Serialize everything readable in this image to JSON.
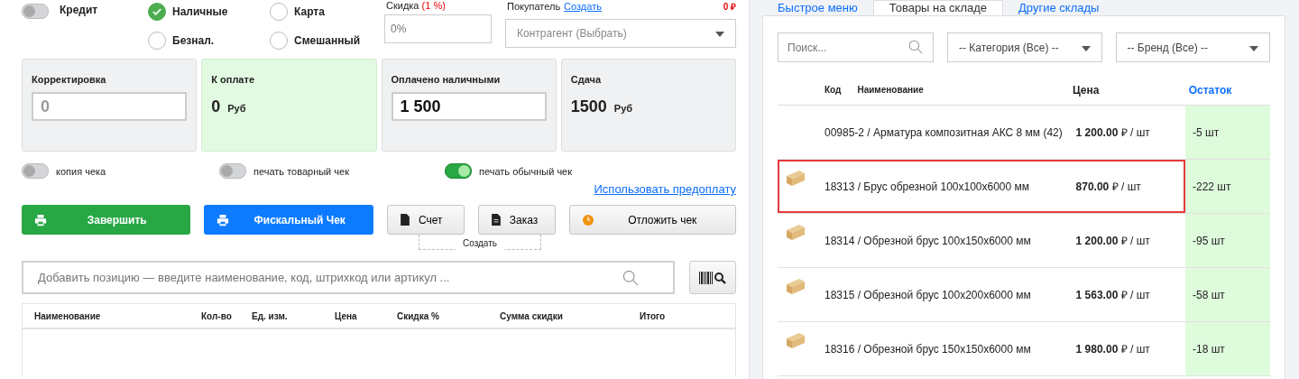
{
  "left": {
    "credit": {
      "label": "Кредит",
      "on": false
    },
    "payment_methods": [
      {
        "label": "Наличные",
        "selected": true
      },
      {
        "label": "Карта",
        "selected": false
      },
      {
        "label": "Безнал.",
        "selected": false
      },
      {
        "label": "Смешанный",
        "selected": false
      }
    ],
    "discount": {
      "label": "Скидка",
      "rate": "(1 %)",
      "placeholder": "0%"
    },
    "buyer": {
      "label": "Покупатель",
      "link": "Создать",
      "amount": "0 ₽",
      "placeholder": "Контрагент (Выбрать)"
    },
    "cards": [
      {
        "kind": "input",
        "title": "Корректировка",
        "placeholder": "0"
      },
      {
        "kind": "total",
        "title": "К оплате",
        "value": "0",
        "unit": "Руб"
      },
      {
        "kind": "input-strong",
        "title": "Оплачено наличными",
        "value": "1 500"
      },
      {
        "kind": "total-grey",
        "title": "Сдача",
        "value": "1500",
        "unit": "Руб"
      }
    ],
    "print_toggles": [
      {
        "label": "копия чека",
        "on": false
      },
      {
        "label": "печать товарный чек",
        "on": false
      },
      {
        "label": "печать обычный чек",
        "on": true
      }
    ],
    "prepay_link": "Использовать предоплату",
    "buttons": [
      {
        "kind": "green",
        "label": "Завершить"
      },
      {
        "kind": "blue",
        "label": "Фискальный Чек"
      },
      {
        "kind": "doc",
        "label": "Счет"
      },
      {
        "kind": "doc-lines",
        "label": "Заказ"
      },
      {
        "kind": "clock",
        "label": "Отложить чек"
      }
    ],
    "create_caption": "Создать",
    "search": {
      "placeholder": "Добавить позицию — введите наименование, код, штрихкод или артикул ..."
    },
    "table": {
      "columns": [
        "Наименование",
        "Кол-во",
        "Ед. изм.",
        "Цена",
        "Скидка %",
        "Сумма скидки",
        "Итого"
      ]
    }
  },
  "right": {
    "tabs": [
      {
        "label": "Быстрое меню",
        "selected": false
      },
      {
        "label": "Товары на складе",
        "selected": true
      },
      {
        "label": "Другие склады",
        "selected": false
      }
    ],
    "search": {
      "placeholder": "Поиск..."
    },
    "category": "-- Категория (Все) --",
    "brand": "-- Бренд (Все) --",
    "columns": [
      "Код",
      "Наименование",
      "Цена",
      "Остаток"
    ],
    "rows": [
      {
        "image": false,
        "name": "00985-2 / Арматура композитная АКС 8 мм (42)",
        "price": "**1 200.00** ₽ / шт",
        "stock": "-5 шт",
        "highlighted": false
      },
      {
        "image": true,
        "name": "18313 / Брус обрезной 100x100x6000 мм",
        "price": "**870.00** ₽ / шт",
        "stock": "-222 шт",
        "highlighted": true
      },
      {
        "image": true,
        "name": "18314 / Обрезной брус 100x150x6000 мм",
        "price": "**1 200.00** ₽ / шт",
        "stock": "-95 шт",
        "highlighted": false
      },
      {
        "image": true,
        "name": "18315 / Обрезной брус 100x200x6000 мм",
        "price": "**1 563.00** ₽ / шт",
        "stock": "-58 шт",
        "highlighted": false
      },
      {
        "image": true,
        "name": "18316 / Обрезной брус 150x150x6000 мм",
        "price": "**1 980.00** ₽ / шт",
        "stock": "-18 шт",
        "highlighted": false
      }
    ]
  }
}
